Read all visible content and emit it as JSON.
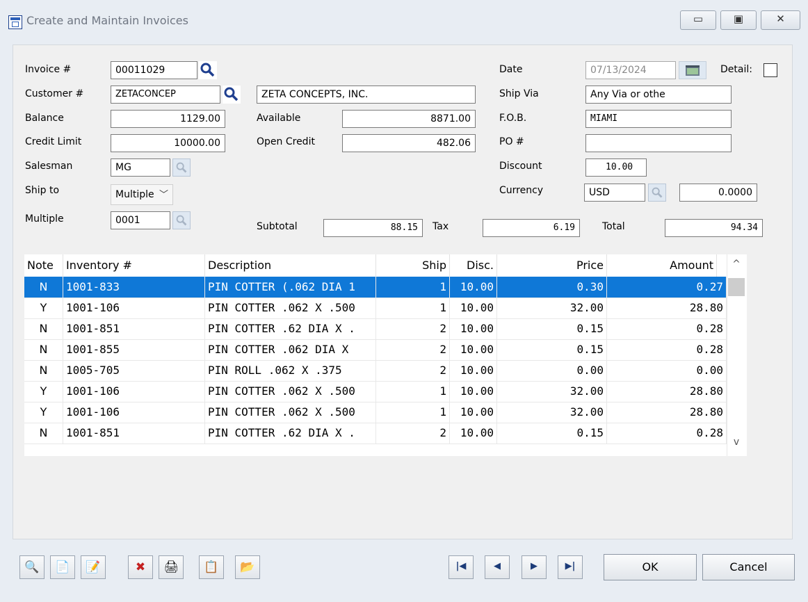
{
  "window": {
    "title": "Create and Maintain Invoices",
    "controls": {
      "minimize": "▭",
      "maximize": "▣",
      "close": "✕"
    }
  },
  "header": {
    "invoice_label": "Invoice #",
    "invoice_value": "00011029",
    "customer_label": "Customer #",
    "customer_value": "ZETACONCEP",
    "customer_name": "ZETA CONCEPTS, INC.",
    "balance_label": "Balance",
    "balance_value": "1129.00",
    "available_label": "Available",
    "available_value": "8871.00",
    "credit_limit_label": "Credit Limit",
    "credit_limit_value": "10000.00",
    "open_credit_label": "Open Credit",
    "open_credit_value": "482.06",
    "salesman_label": "Salesman",
    "salesman_value": "MG",
    "ship_to_label": "Ship to",
    "ship_to_value": "Multiple",
    "multiple_label": "Multiple",
    "multiple_value": "0001",
    "date_label": "Date",
    "date_value": "07/13/2024",
    "detail_label": "Detail:",
    "ship_via_label": "Ship Via",
    "ship_via_value": "Any Via or othe",
    "fob_label": "F.O.B.",
    "fob_value": "MIAMI",
    "po_label": "PO #",
    "po_value": "",
    "discount_label": "Discount",
    "discount_value": "10.00",
    "currency_label": "Currency",
    "currency_value": "USD",
    "currency_rate": "0.0000"
  },
  "totals": {
    "subtotal_label": "Subtotal",
    "subtotal_value": "88.15",
    "tax_label": "Tax",
    "tax_value": "6.19",
    "total_label": "Total",
    "total_value": "94.34"
  },
  "grid": {
    "columns": [
      "Note",
      "Inventory #",
      "Description",
      "Ship",
      "Disc.",
      "Price",
      "Amount"
    ],
    "rows": [
      {
        "note": "N",
        "inventory": "1001-833",
        "description": "PIN COTTER (.062 DIA 1",
        "ship": "1",
        "disc": "10.00",
        "price": "0.30",
        "amount": "0.27"
      },
      {
        "note": "Y",
        "inventory": "1001-106",
        "description": "PIN COTTER .062 X .500",
        "ship": "1",
        "disc": "10.00",
        "price": "32.00",
        "amount": "28.80"
      },
      {
        "note": "N",
        "inventory": "1001-851",
        "description": "PIN COTTER .62 DIA X .",
        "ship": "2",
        "disc": "10.00",
        "price": "0.15",
        "amount": "0.28"
      },
      {
        "note": "N",
        "inventory": "1001-855",
        "description": "PIN COTTER .062 DIA X",
        "ship": "2",
        "disc": "10.00",
        "price": "0.15",
        "amount": "0.28"
      },
      {
        "note": "N",
        "inventory": "1005-705",
        "description": "PIN ROLL .062 X .375",
        "ship": "2",
        "disc": "10.00",
        "price": "0.00",
        "amount": "0.00"
      },
      {
        "note": "Y",
        "inventory": "1001-106",
        "description": "PIN COTTER .062 X .500",
        "ship": "1",
        "disc": "10.00",
        "price": "32.00",
        "amount": "28.80"
      },
      {
        "note": "Y",
        "inventory": "1001-106",
        "description": "PIN COTTER .062 X .500",
        "ship": "1",
        "disc": "10.00",
        "price": "32.00",
        "amount": "28.80"
      },
      {
        "note": "N",
        "inventory": "1001-851",
        "description": "PIN COTTER .62 DIA X .",
        "ship": "2",
        "disc": "10.00",
        "price": "0.15",
        "amount": "0.28"
      }
    ],
    "scroll_up": "^",
    "scroll_down": "v"
  },
  "toolbar": {
    "icons": [
      "🔍",
      "📄",
      "📝",
      "✖",
      "🖨",
      "📋",
      "📂"
    ],
    "nav": [
      "|◀",
      "◀",
      "▶",
      "▶|"
    ],
    "ok_label": "OK",
    "cancel_label": "Cancel"
  }
}
